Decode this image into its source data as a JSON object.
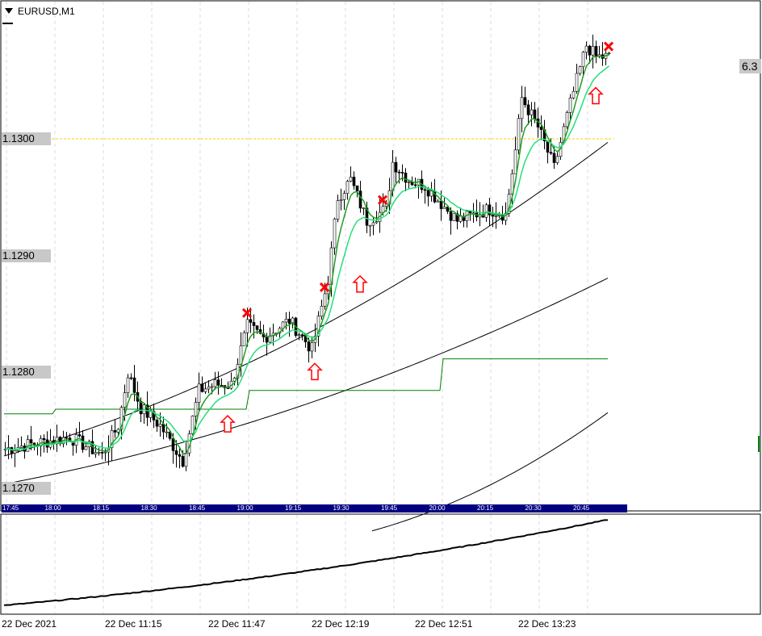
{
  "header": {
    "symbol": "EURUSD,M1"
  },
  "price_labels": [
    "1.1300",
    "1.1290",
    "1.1280",
    "1.1270"
  ],
  "right_value": "6.3",
  "time_labels": [
    "17:45",
    "18:00",
    "18:15",
    "18:30",
    "18:45",
    "19:00",
    "19:15",
    "19:30",
    "19:45",
    "20:00",
    "20:15",
    "20:30",
    "20:45"
  ],
  "date_labels": [
    "22 Dec 2021",
    "22 Dec 11:15",
    "22 Dec 11:47",
    "22 Dec 12:19",
    "22 Dec 12:51",
    "22 Dec 13:23"
  ],
  "colors": {
    "bull": "#ffffff",
    "bear": "#000000",
    "ema_fast": "#1f9e1f",
    "ema_slow": "#22e07a",
    "level": "#ffcc00",
    "axis_bar": "#000080",
    "signal": "#ff0000"
  },
  "chart_data": {
    "type": "line",
    "title": "EURUSD,M1",
    "ylim": [
      1.1268,
      1.1311
    ],
    "level": 1.13,
    "close_anchors": [
      [
        0,
        1.12735
      ],
      [
        10,
        1.1274
      ],
      [
        20,
        1.12745
      ],
      [
        30,
        1.1273
      ],
      [
        35,
        1.12755
      ],
      [
        38,
        1.128
      ],
      [
        42,
        1.1277
      ],
      [
        48,
        1.12755
      ],
      [
        55,
        1.12725
      ],
      [
        60,
        1.12785
      ],
      [
        65,
        1.1279
      ],
      [
        70,
        1.1279
      ],
      [
        75,
        1.1284
      ],
      [
        80,
        1.1283
      ],
      [
        88,
        1.12845
      ],
      [
        95,
        1.1282
      ],
      [
        100,
        1.1288
      ],
      [
        103,
        1.1295
      ],
      [
        107,
        1.12965
      ],
      [
        112,
        1.1293
      ],
      [
        118,
        1.1294
      ],
      [
        120,
        1.1298
      ],
      [
        125,
        1.12965
      ],
      [
        130,
        1.1296
      ],
      [
        140,
        1.1293
      ],
      [
        150,
        1.1294
      ],
      [
        155,
        1.12935
      ],
      [
        158,
        1.1299
      ],
      [
        160,
        1.13035
      ],
      [
        165,
        1.1301
      ],
      [
        170,
        1.12975
      ],
      [
        175,
        1.1303
      ],
      [
        180,
        1.1308
      ],
      [
        183,
        1.1307
      ],
      [
        187,
        1.1307
      ]
    ],
    "ma_long": [
      {
        "name": "ma1",
        "from": [
          0,
          1.12729
        ],
        "to": [
          187,
          1.12997
        ]
      },
      {
        "name": "ma2",
        "from": [
          0,
          1.12705
        ],
        "to": [
          187,
          1.12881
        ]
      },
      {
        "name": "ma3",
        "from": [
          114,
          1.12665
        ],
        "to": [
          187,
          1.12766
        ]
      }
    ],
    "step_line": [
      [
        0,
        1.12765
      ],
      [
        16,
        1.12769
      ],
      [
        76,
        1.12785
      ],
      [
        136,
        1.12812
      ],
      [
        187,
        1.12812
      ]
    ],
    "buy_arrows": [
      69,
      96,
      110,
      183
    ],
    "sell_marks": [
      75,
      99,
      117,
      187
    ],
    "indicator": {
      "from": 0.0,
      "to": 1.0
    }
  }
}
